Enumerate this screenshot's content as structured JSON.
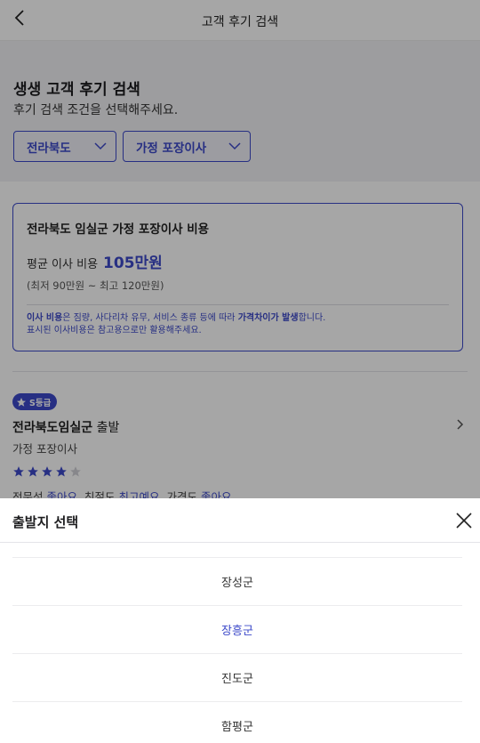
{
  "topbar": {
    "title": "고객 후기 검색"
  },
  "header": {
    "title": "생생 고객 후기 검색",
    "subtitle": "후기 검색 조건을 선택해주세요.",
    "region_dropdown": "전라북도",
    "service_dropdown": "가정 포장이사"
  },
  "cost_card": {
    "title": "전라북도 임실군 가정 포장이사 비용",
    "avg_label": "평균 이사 비용",
    "avg_value": "105만원",
    "range": "(최저 90만원 ~ 최고 120만원)",
    "notice_part1_bold": "이사 비용",
    "notice_part1": "은 짐량, 사다리차 유무, 서비스 종류 등에 따라 ",
    "notice_part1_bold2": "가격차이가 발생",
    "notice_part1_end": "합니다.",
    "notice_line2": "표시된 이사비용은 참고용으로만 활용해주세요."
  },
  "review": {
    "grade": "S등급",
    "title_bold": "전라북도임실군",
    "title_normal": " 출발",
    "type": "가정 포장이사",
    "rating": 4,
    "max_rating": 5,
    "ratings_text": {
      "expertise_label": "전문성",
      "expertise_value": "좋아요",
      "kindness_label": "친절도",
      "kindness_value": "최고예요",
      "price_label": "가격도",
      "price_value": "좋아요"
    }
  },
  "sheet": {
    "title": "출발지 선택",
    "items": [
      "장성군",
      "장흥군",
      "진도군",
      "함평군"
    ],
    "selected_index": 1
  },
  "colors": {
    "accent": "#3c49c9",
    "overlay": "rgba(0,0,0,0.35)"
  }
}
